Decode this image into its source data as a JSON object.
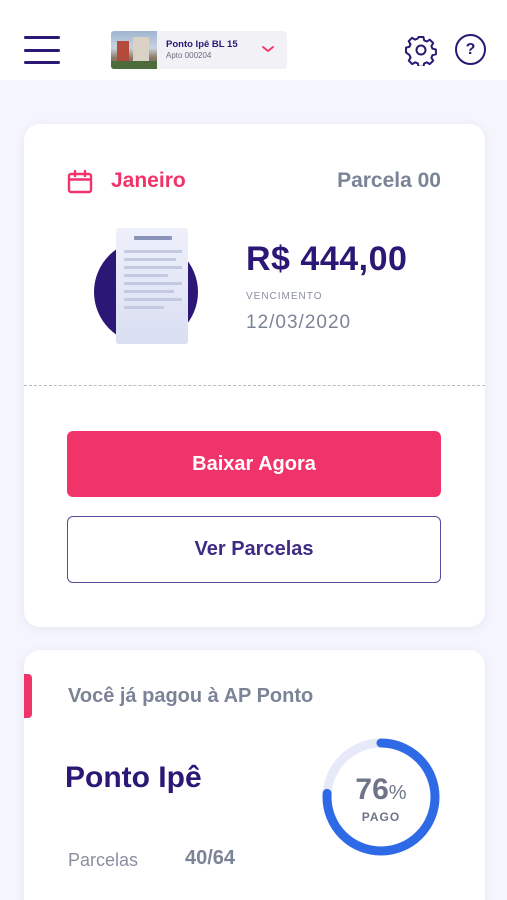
{
  "header": {
    "property_name": "Ponto Ipê BL 15",
    "property_unit": "Apto 000204"
  },
  "installment_card": {
    "month": "Janeiro",
    "installment": "Parcela 00",
    "amount": "R$ 444,00",
    "due_label": "VENCIMENTO",
    "due_date": "12/03/2020",
    "download_button": "Baixar Agora",
    "view_button": "Ver Parcelas"
  },
  "progress_card": {
    "title": "Você já pagou à AP Ponto",
    "project": "Ponto Ipê",
    "installments_label": "Parcelas",
    "installments_count": "40/64",
    "percent_value": 76,
    "percent_number": "76",
    "percent_sign": "%",
    "percent_label": "PAGO"
  },
  "colors": {
    "primary_dark": "#2b1775",
    "accent_pink": "#f0346a",
    "muted_gray": "#7b8497",
    "ring_blue": "#2f6ae6",
    "ring_track": "#e6eaf8"
  },
  "icons": {
    "menu": "hamburger-icon",
    "dropdown": "chevron-down-icon",
    "settings": "gear-icon",
    "help": "question-icon",
    "calendar": "calendar-icon"
  }
}
